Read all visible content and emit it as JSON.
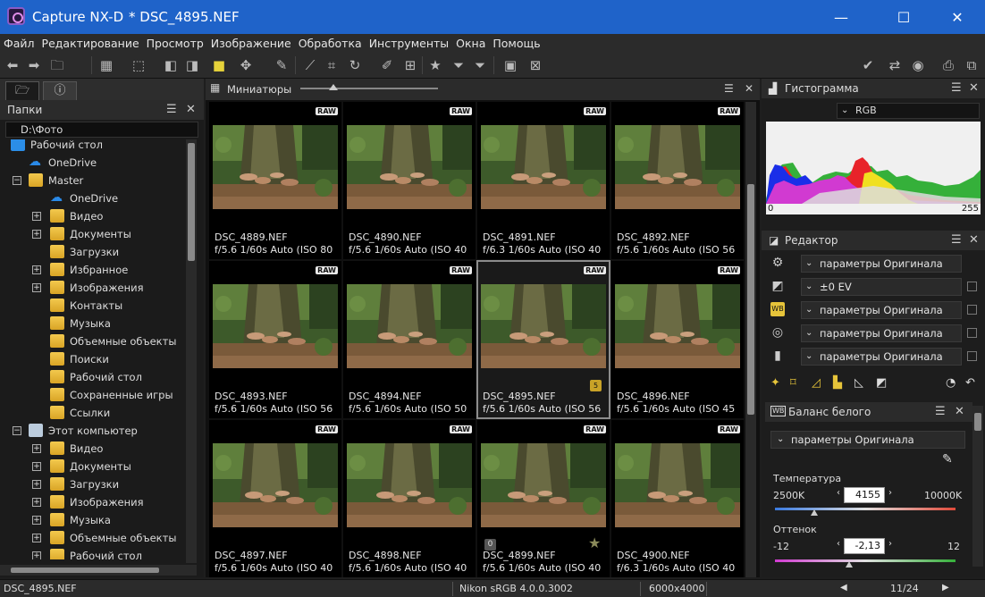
{
  "window": {
    "app_title": "Capture NX-D",
    "file_title": "* DSC_4895.NEF",
    "minimize_glyph": "—",
    "maximize_glyph": "☐",
    "close_glyph": "✕"
  },
  "menu": [
    "Файл",
    "Редактирование",
    "Просмотр",
    "Изображение",
    "Обработка",
    "Инструменты",
    "Окна",
    "Помощь"
  ],
  "left_panel": {
    "tab_icons": [
      "folder-icon",
      "info-icon"
    ],
    "title": "Папки",
    "path": "D:\\Фото",
    "tree": [
      {
        "label": "Рабочий стол",
        "icon": "desktop-icon",
        "level": 0,
        "expander": ""
      },
      {
        "label": "OneDrive",
        "icon": "onedrive-icon",
        "level": 1,
        "expander": ""
      },
      {
        "label": "Master",
        "icon": "folder-icon",
        "level": 1,
        "expander": "−"
      },
      {
        "label": "OneDrive",
        "icon": "onedrive-icon",
        "level": 2,
        "expander": ""
      },
      {
        "label": "Видео",
        "icon": "folder-icon",
        "level": 2,
        "expander": "+"
      },
      {
        "label": "Документы",
        "icon": "folder-icon",
        "level": 2,
        "expander": "+"
      },
      {
        "label": "Загрузки",
        "icon": "folder-icon",
        "level": 2,
        "expander": ""
      },
      {
        "label": "Избранное",
        "icon": "folder-icon",
        "level": 2,
        "expander": "+"
      },
      {
        "label": "Изображения",
        "icon": "folder-icon",
        "level": 2,
        "expander": "+"
      },
      {
        "label": "Контакты",
        "icon": "folder-icon",
        "level": 2,
        "expander": ""
      },
      {
        "label": "Музыка",
        "icon": "folder-icon",
        "level": 2,
        "expander": ""
      },
      {
        "label": "Объемные объекты",
        "icon": "folder-icon",
        "level": 2,
        "expander": ""
      },
      {
        "label": "Поиски",
        "icon": "folder-icon",
        "level": 2,
        "expander": ""
      },
      {
        "label": "Рабочий стол",
        "icon": "folder-icon",
        "level": 2,
        "expander": ""
      },
      {
        "label": "Сохраненные игры",
        "icon": "folder-icon",
        "level": 2,
        "expander": ""
      },
      {
        "label": "Ссылки",
        "icon": "folder-icon",
        "level": 2,
        "expander": ""
      },
      {
        "label": "Этот компьютер",
        "icon": "computer-icon",
        "level": 1,
        "expander": "−"
      },
      {
        "label": "Видео",
        "icon": "folder-icon",
        "level": 2,
        "expander": "+"
      },
      {
        "label": "Документы",
        "icon": "folder-icon",
        "level": 2,
        "expander": "+"
      },
      {
        "label": "Загрузки",
        "icon": "folder-icon",
        "level": 2,
        "expander": "+"
      },
      {
        "label": "Изображения",
        "icon": "folder-icon",
        "level": 2,
        "expander": "+"
      },
      {
        "label": "Музыка",
        "icon": "folder-icon",
        "level": 2,
        "expander": "+"
      },
      {
        "label": "Объемные объекты",
        "icon": "folder-icon",
        "level": 2,
        "expander": "+"
      },
      {
        "label": "Рабочий стол",
        "icon": "folder-icon",
        "level": 2,
        "expander": "+"
      }
    ]
  },
  "thumbnails": {
    "title": "Миниатюры",
    "raw_label": "RAW",
    "items": [
      {
        "name": "DSC_4889.NEF",
        "info": "f/5.6 1/60s Auto (ISO 80",
        "selected": false,
        "badge": "",
        "zero": "",
        "star": false
      },
      {
        "name": "DSC_4890.NEF",
        "info": "f/5.6 1/60s Auto (ISO 40",
        "selected": false,
        "badge": "",
        "zero": "",
        "star": false
      },
      {
        "name": "DSC_4891.NEF",
        "info": "f/6.3 1/60s Auto (ISO 40",
        "selected": false,
        "badge": "",
        "zero": "",
        "star": false
      },
      {
        "name": "DSC_4892.NEF",
        "info": "f/5.6 1/60s Auto (ISO 56",
        "selected": false,
        "badge": "",
        "zero": "",
        "star": false
      },
      {
        "name": "DSC_4893.NEF",
        "info": "f/5.6 1/60s Auto (ISO 56",
        "selected": false,
        "badge": "",
        "zero": "",
        "star": false
      },
      {
        "name": "DSC_4894.NEF",
        "info": "f/5.6 1/60s Auto (ISO 50",
        "selected": false,
        "badge": "",
        "zero": "",
        "star": false
      },
      {
        "name": "DSC_4895.NEF",
        "info": "f/5.6 1/60s Auto (ISO 56",
        "selected": true,
        "badge": "5",
        "zero": "",
        "star": false
      },
      {
        "name": "DSC_4896.NEF",
        "info": "f/5.6 1/60s Auto (ISO 45",
        "selected": false,
        "badge": "",
        "zero": "",
        "star": false
      },
      {
        "name": "DSC_4897.NEF",
        "info": "f/5.6 1/60s Auto (ISO 40",
        "selected": false,
        "badge": "",
        "zero": "",
        "star": false
      },
      {
        "name": "DSC_4898.NEF",
        "info": "f/5.6 1/60s Auto (ISO 40",
        "selected": false,
        "badge": "",
        "zero": "",
        "star": false
      },
      {
        "name": "DSC_4899.NEF",
        "info": "f/5.6 1/60s Auto (ISO 40",
        "selected": false,
        "badge": "",
        "zero": "0",
        "star": true
      },
      {
        "name": "DSC_4900.NEF",
        "info": "f/6.3 1/60s Auto (ISO 40",
        "selected": false,
        "badge": "",
        "zero": "",
        "star": false
      }
    ]
  },
  "histogram": {
    "title": "Гистограмма",
    "channel": "RGB",
    "min_label": "0",
    "max_label": "255"
  },
  "editor": {
    "title": "Редактор",
    "rows": [
      {
        "icon": "gear-icon",
        "value": "параметры Оригинала",
        "has_check": false
      },
      {
        "icon": "exposure-icon",
        "value": "±0 EV",
        "has_check": true
      },
      {
        "icon": "white-balance-icon",
        "value": "параметры Оригинала",
        "has_check": true
      },
      {
        "icon": "picture-control-icon",
        "value": "параметры Оригинала",
        "has_check": true
      },
      {
        "icon": "camera-icon",
        "value": "параметры Оригинала",
        "has_check": true
      }
    ]
  },
  "white_balance": {
    "title": "Баланс белого",
    "mode": "параметры Оригинала",
    "temperature_label": "Температура",
    "temp_min": "2500K",
    "temp_max": "10000K",
    "temp_value": "4155",
    "temp_position": 0.22,
    "tint_label": "Оттенок",
    "tint_min": "-12",
    "tint_max": "12",
    "tint_value": "-2,13",
    "tint_position": 0.41
  },
  "status": {
    "file": "DSC_4895.NEF",
    "profile": "Nikon sRGB 4.0.0.3002",
    "size": "6000x4000",
    "count": "11/24"
  },
  "colors": {
    "title_bar": "#1f63c9",
    "panel_bg": "#1d1d1d",
    "hist_red": "#e8232a",
    "hist_green": "#35b03a",
    "hist_blue": "#1a2ee8",
    "hist_yellow": "#f0e020",
    "hist_magenta": "#d13ad1"
  }
}
